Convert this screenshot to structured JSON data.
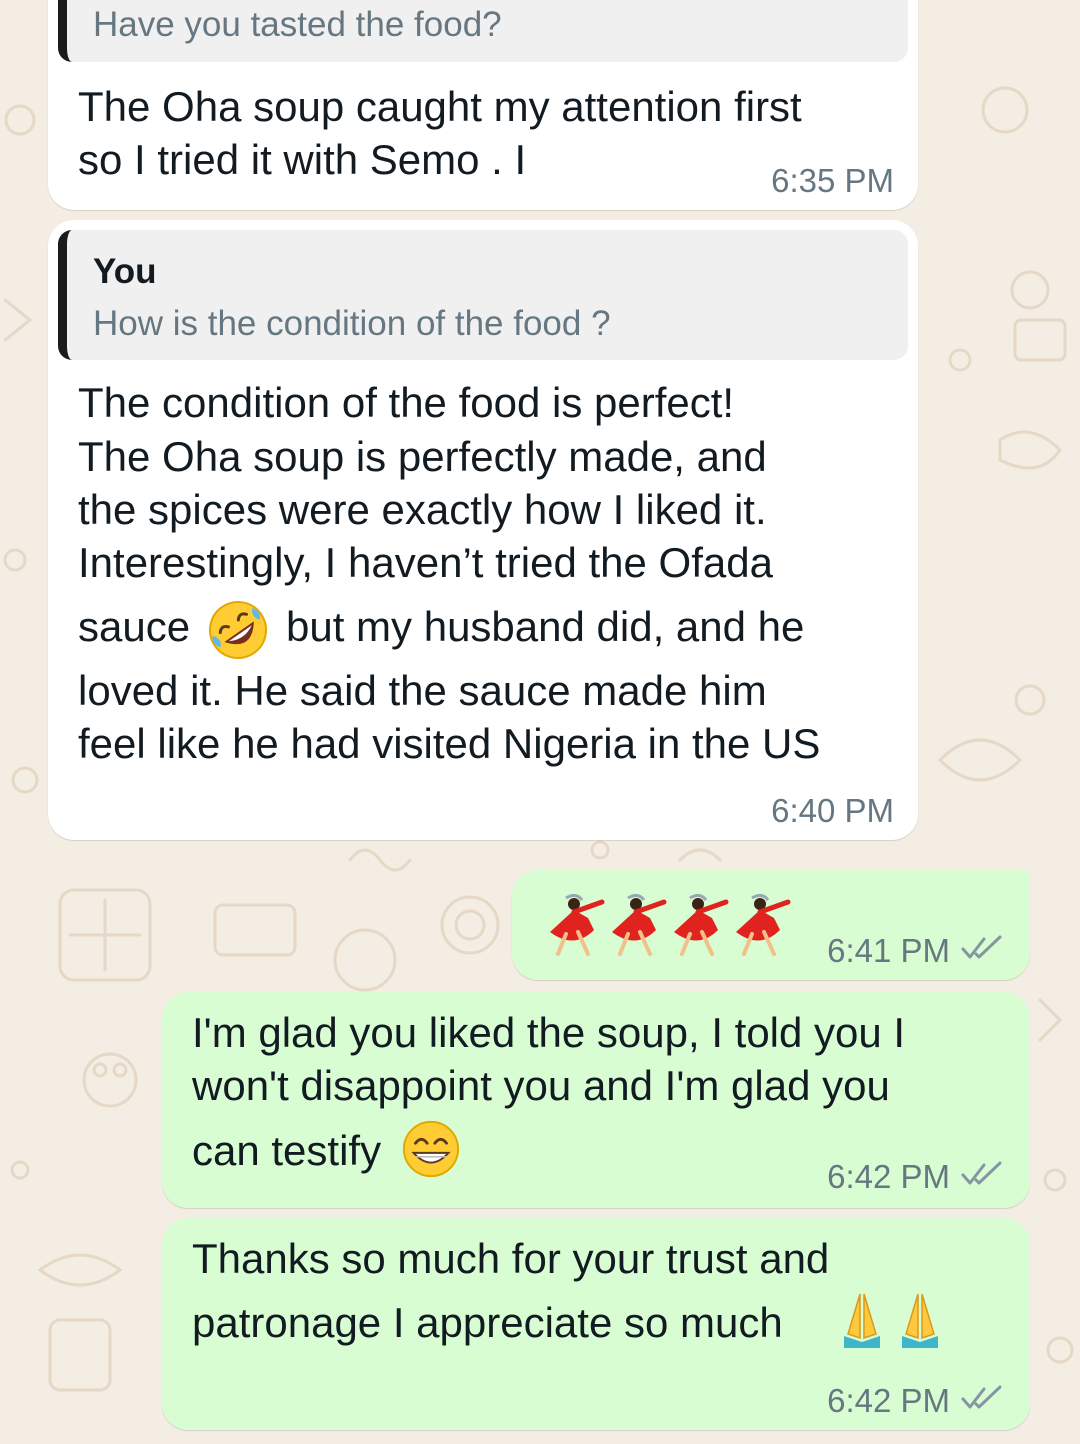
{
  "messages": [
    {
      "direction": "incoming",
      "quote": {
        "text": "Have you tasted the food?"
      },
      "lines": [
        "The Oha soup caught my attention first",
        "so I tried it with Semo . I"
      ],
      "time": "6:35 PM"
    },
    {
      "direction": "incoming",
      "quote": {
        "author": "You",
        "text": "How is the condition of the food ?"
      },
      "lines": [
        "The condition of the food is perfect!",
        "The Oha soup is perfectly made, and",
        "the spices were exactly how I liked it.",
        "Interestingly, I haven’t tried the Ofada",
        "sauce",
        "but my husband did, and he",
        "loved it. He said the sauce made him",
        "feel like he had visited Nigeria in the US"
      ],
      "emoji": "rolling-on-floor-laughing",
      "time": "6:40 PM"
    },
    {
      "direction": "outgoing",
      "emoji": "woman-dancing x4",
      "time": "6:41 PM",
      "status": "delivered-double-tick"
    },
    {
      "direction": "outgoing",
      "lines": [
        "I'm glad you liked the soup, I told you I",
        "won't disappoint you and I'm glad you",
        "can testify"
      ],
      "emoji": "beaming-face-with-smiling-eyes",
      "time": "6:42 PM",
      "status": "delivered-double-tick"
    },
    {
      "direction": "outgoing",
      "lines": [
        "Thanks so much for your trust and",
        "patronage I appreciate so much"
      ],
      "emoji": "folded-hands x2",
      "time": "6:42 PM",
      "status": "delivered-double-tick"
    }
  ],
  "colors": {
    "incoming_bubble": "#ffffff",
    "outgoing_bubble": "#d9fdd3",
    "wallpaper": "#f4ede3",
    "meta_text": "#667781",
    "quote_bar": "#1b1b1b"
  }
}
